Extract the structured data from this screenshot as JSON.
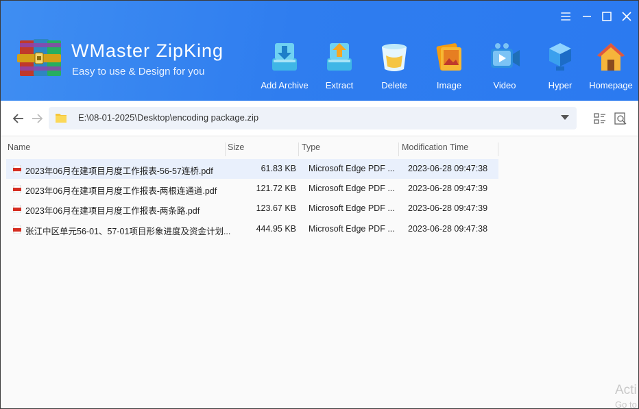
{
  "app": {
    "title": "WMaster ZipKing",
    "subtitle": "Easy to use & Design for you"
  },
  "window_controls": {
    "menu_icon": "menu-icon",
    "minimize_icon": "minimize-icon",
    "maximize_icon": "maximize-icon",
    "close_icon": "close-icon"
  },
  "toolbar": {
    "add_archive": "Add Archive",
    "extract": "Extract",
    "delete": "Delete",
    "image": "Image",
    "video": "Video",
    "hyper": "Hyper",
    "homepage": "Homepage"
  },
  "address": {
    "path": "E:\\08-01-2025\\Desktop\\encoding package.zip"
  },
  "columns": {
    "name": "Name",
    "size": "Size",
    "type": "Type",
    "modified": "Modification Time"
  },
  "files": [
    {
      "name": "2023年06月在建项目月度工作报表-56-57连桥.pdf",
      "size": "61.83 KB",
      "type": "Microsoft Edge PDF ...",
      "modified": "2023-06-28 09:47:38",
      "selected": true
    },
    {
      "name": "2023年06月在建项目月度工作报表-两根连通道.pdf",
      "size": "121.72 KB",
      "type": "Microsoft Edge PDF ...",
      "modified": "2023-06-28 09:47:39",
      "selected": false
    },
    {
      "name": "2023年06月在建项目月度工作报表-两条路.pdf",
      "size": "123.67 KB",
      "type": "Microsoft Edge PDF ...",
      "modified": "2023-06-28 09:47:39",
      "selected": false
    },
    {
      "name": "张江中区单元56-01、57-01项目形象进度及资金计划...",
      "size": "444.95 KB",
      "type": "Microsoft Edge PDF ...",
      "modified": "2023-06-28 09:47:38",
      "selected": false
    }
  ],
  "watermark": {
    "line1": "Acti",
    "line2": "Go to"
  },
  "colors": {
    "header": "#2f7def",
    "selected_row": "#e9f0fc",
    "path_box": "#eef2f9"
  }
}
